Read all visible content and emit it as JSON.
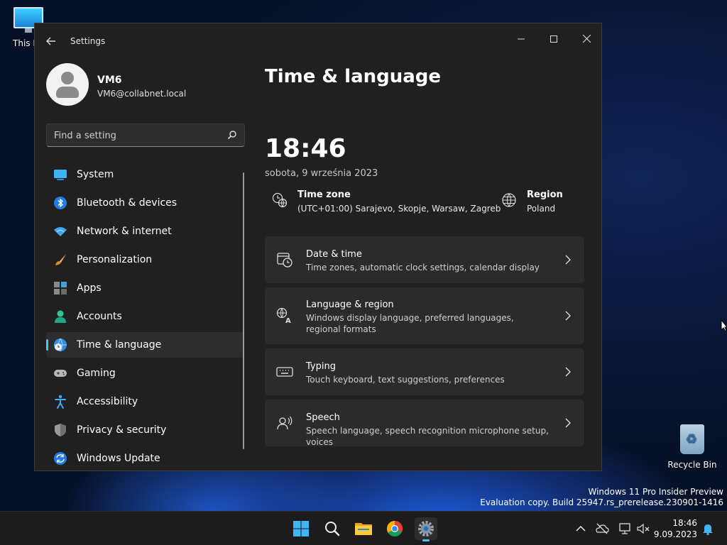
{
  "desktop": {
    "icons": [
      {
        "label": "This PC"
      },
      {
        "label": "Recycle Bin"
      }
    ],
    "watermark": {
      "line1": "Windows 11 Pro Insider Preview",
      "line2": "Evaluation copy. Build 25947.rs_prerelease.230901-1416"
    }
  },
  "window": {
    "title": "Settings",
    "controls": [
      "minimize-icon",
      "maximize-icon",
      "close-icon"
    ]
  },
  "profile": {
    "name": "VM6",
    "email": "VM6@collabnet.local"
  },
  "search": {
    "placeholder": "Find a setting"
  },
  "nav": {
    "items": [
      {
        "label": "System",
        "icon": "system-icon"
      },
      {
        "label": "Bluetooth & devices",
        "icon": "bluetooth-icon"
      },
      {
        "label": "Network & internet",
        "icon": "wifi-icon"
      },
      {
        "label": "Personalization",
        "icon": "brush-icon"
      },
      {
        "label": "Apps",
        "icon": "apps-icon"
      },
      {
        "label": "Accounts",
        "icon": "accounts-icon"
      },
      {
        "label": "Time & language",
        "icon": "globe-clock-icon",
        "active": true
      },
      {
        "label": "Gaming",
        "icon": "gamepad-icon"
      },
      {
        "label": "Accessibility",
        "icon": "accessibility-icon"
      },
      {
        "label": "Privacy & security",
        "icon": "shield-icon"
      },
      {
        "label": "Windows Update",
        "icon": "update-icon"
      }
    ]
  },
  "main": {
    "title": "Time & language",
    "time": "18:46",
    "date": "sobota, 9 września 2023",
    "time_zone": {
      "title": "Time zone",
      "value": "(UTC+01:00) Sarajevo, Skopje, Warsaw, Zagreb"
    },
    "region": {
      "title": "Region",
      "value": "Poland"
    },
    "cards": [
      {
        "title": "Date & time",
        "subtitle": "Time zones, automatic clock settings, calendar display",
        "icon": "calendar-clock-icon"
      },
      {
        "title": "Language & region",
        "subtitle": "Windows display language, preferred languages, regional formats",
        "icon": "language-icon"
      },
      {
        "title": "Typing",
        "subtitle": "Touch keyboard, text suggestions, preferences",
        "icon": "keyboard-icon"
      },
      {
        "title": "Speech",
        "subtitle": "Speech language, speech recognition microphone setup, voices",
        "icon": "speech-icon"
      }
    ]
  },
  "taskbar": {
    "apps": [
      "start-icon",
      "search-icon",
      "file-explorer-icon",
      "chrome-icon",
      "settings-icon"
    ],
    "clock": {
      "time": "18:46",
      "date": "9.09.2023"
    }
  },
  "colors": {
    "accent": "#4cc2ff",
    "window_bg": "#202020",
    "card_bg": "#2b2b2b"
  }
}
